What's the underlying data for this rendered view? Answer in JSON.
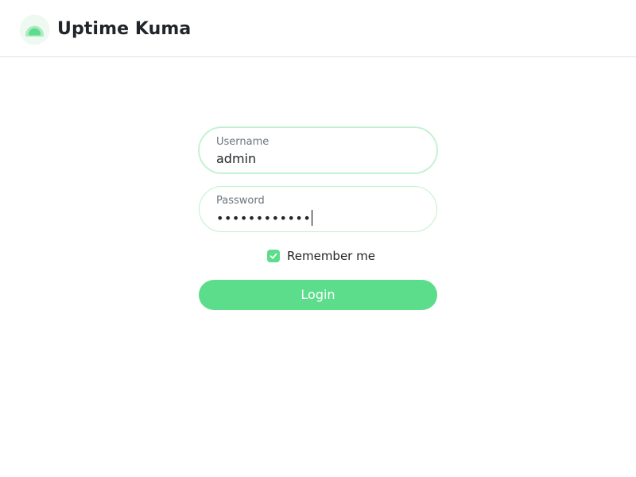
{
  "app": {
    "title": "Uptime Kuma",
    "logo_icon": "uptime-kuma-logo",
    "accent_color": "#5cdd8b"
  },
  "login_form": {
    "username": {
      "label": "Username",
      "value": "admin"
    },
    "password": {
      "label": "Password",
      "value": "••••••••••••"
    },
    "remember_me": {
      "label": "Remember me",
      "checked": true
    },
    "login_button": {
      "label": "Login"
    }
  }
}
